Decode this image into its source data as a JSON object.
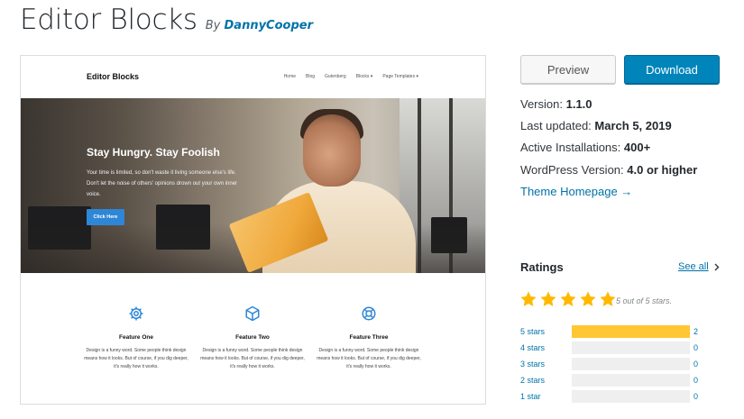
{
  "header": {
    "title": "Editor Blocks",
    "by": "By",
    "author": "DannyCooper"
  },
  "screenshot": {
    "logo": "Editor Blocks",
    "menu": [
      "Home",
      "Blog",
      "Gutenberg",
      "Blocks ▾",
      "Page Templates ▾"
    ],
    "hero": {
      "heading": "Stay Hungry. Stay Foolish",
      "text": "Your time is limited, so don't waste it living someone else's life. Don't let the noise of others' opinions drown out your own inner voice.",
      "button": "Click Here"
    },
    "features": [
      {
        "icon": "gear-icon",
        "name": "Feature One",
        "desc": "Design is a funny word. Some people think design means how it looks. But of course, if you dig deeper, it's really how it works."
      },
      {
        "icon": "cube-icon",
        "name": "Feature Two",
        "desc": "Design is a funny word. Some people think design means how it looks. But of course, if you dig deeper, it's really how it works."
      },
      {
        "icon": "lifebuoy-icon",
        "name": "Feature Three",
        "desc": "Design is a funny word. Some people think design means how it looks. But of course, if you dig deeper, it's really how it works."
      }
    ]
  },
  "actions": {
    "preview": "Preview",
    "download": "Download"
  },
  "meta": {
    "version_label": "Version:",
    "version": "1.1.0",
    "updated_label": "Last updated:",
    "updated": "March 5, 2019",
    "installs_label": "Active Installations:",
    "installs": "400+",
    "wp_label": "WordPress Version:",
    "wp": "4.0 or higher",
    "homepage": "Theme Homepage →"
  },
  "ratings": {
    "title": "Ratings",
    "see_all": "See all",
    "average_stars": 5,
    "caption": "5 out of 5 stars.",
    "rows": [
      {
        "label": "5 stars",
        "count": "2",
        "fraction": 1.0
      },
      {
        "label": "4 stars",
        "count": "0",
        "fraction": 0
      },
      {
        "label": "3 stars",
        "count": "0",
        "fraction": 0
      },
      {
        "label": "2 stars",
        "count": "0",
        "fraction": 0
      },
      {
        "label": "1 star",
        "count": "0",
        "fraction": 0
      }
    ]
  },
  "colors": {
    "link": "#0073aa",
    "download_button": "#0085ba",
    "star": "#ffb900",
    "bar_fill": "#ffc733",
    "hero_button": "#2e86d6",
    "feature_icon": "#2e86d6"
  }
}
